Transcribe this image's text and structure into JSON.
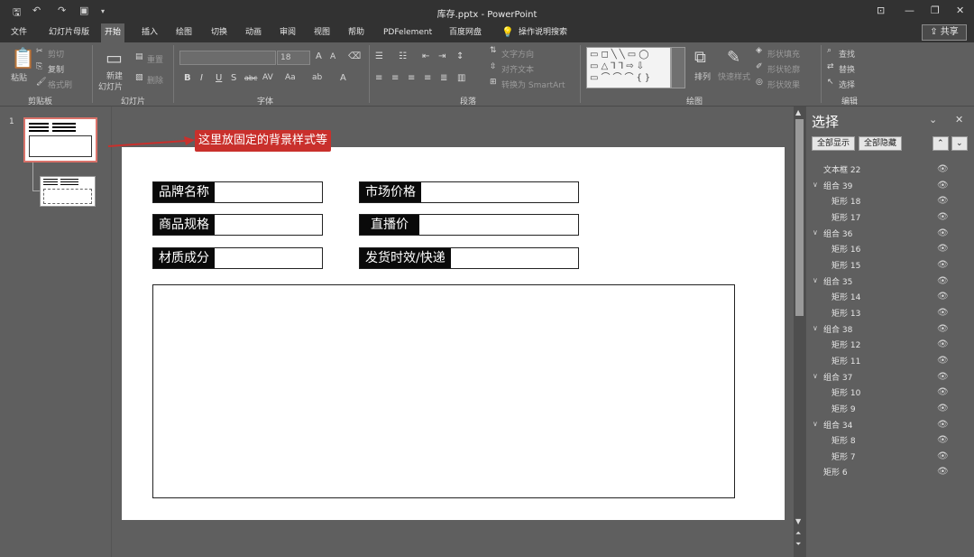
{
  "window": {
    "title": "库存.pptx  -  PowerPoint"
  },
  "tabs": [
    "文件",
    "幻灯片母版",
    "开始",
    "插入",
    "绘图",
    "切换",
    "动画",
    "审阅",
    "视图",
    "帮助",
    "PDFelement",
    "百度网盘"
  ],
  "tell_me": "操作说明搜索",
  "share": "共享",
  "ribbon": {
    "clipboard": {
      "paste": "粘贴",
      "cut": "剪切",
      "copy": "复制",
      "format_painter": "格式刷",
      "label": "剪贴板"
    },
    "slides": {
      "new_slide_1": "新建",
      "new_slide_2": "幻灯片",
      "reset": "重置",
      "delete": "删除",
      "label": "幻灯片"
    },
    "font": {
      "size": "18",
      "label": "字体"
    },
    "paragraph": {
      "text_direction": "文字方向",
      "align_text": "对齐文本",
      "smartart": "转换为 SmartArt",
      "label": "段落"
    },
    "drawing": {
      "arrange": "排列",
      "quick_styles": "快速样式",
      "shape_fill": "形状填充",
      "shape_outline": "形状轮廓",
      "shape_effects": "形状效果",
      "label": "绘图"
    },
    "editing": {
      "find": "查找",
      "replace": "替换",
      "select": "选择",
      "label": "编辑"
    }
  },
  "thumbs": {
    "slide_number": "1"
  },
  "slide": {
    "callout": "这里放固定的背景样式等",
    "fields": {
      "brand": "品牌名称",
      "market_price": "市场价格",
      "spec": "商品规格",
      "live_price": "直播价",
      "material": "材质成分",
      "shipping": "发货时效/快递"
    }
  },
  "selection_pane": {
    "title": "选择",
    "show_all": "全部显示",
    "hide_all": "全部隐藏",
    "items": [
      "文本框 22",
      "组合 39",
      "矩形 18",
      "矩形 17",
      "组合 36",
      "矩形 16",
      "矩形 15",
      "组合 35",
      "矩形 14",
      "矩形 13",
      "组合 38",
      "矩形 12",
      "矩形 11",
      "组合 37",
      "矩形 10",
      "矩形 9",
      "组合 34",
      "矩形 8",
      "矩形 7",
      "矩形 6"
    ]
  },
  "colors": {
    "accent_red": "#c9302c",
    "ui_dark": "#323232",
    "ui_mid": "#5f5f5f"
  }
}
